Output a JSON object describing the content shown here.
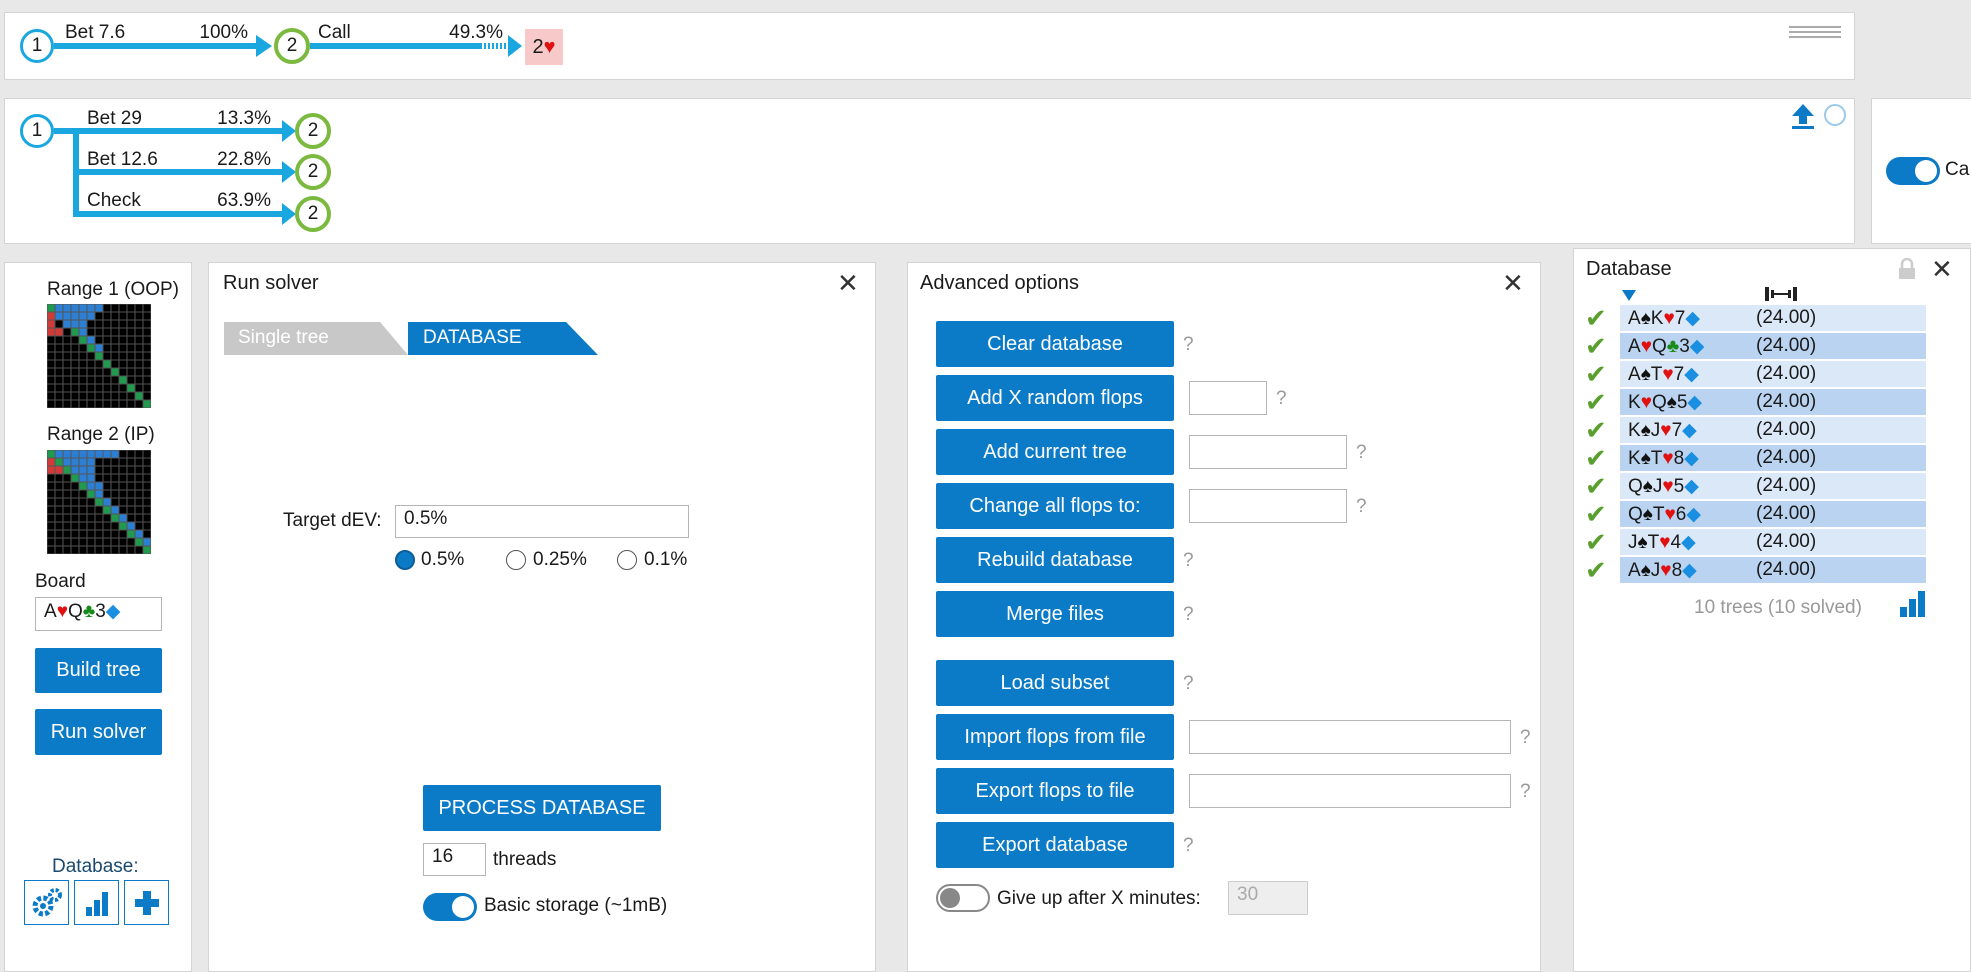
{
  "line1": {
    "node_a": "1",
    "action1": "Bet 7.6",
    "action1_pct": "100%",
    "node_b": "2",
    "action2": "Call",
    "action2_pct": "49.3%",
    "card_rank": "2",
    "card_suit": "♥"
  },
  "line2": {
    "node_root": "1",
    "branches": [
      {
        "label": "Bet 29",
        "pct": "13.3%",
        "node": "2"
      },
      {
        "label": "Bet 12.6",
        "pct": "22.8%",
        "node": "2"
      },
      {
        "label": "Check",
        "pct": "63.9%",
        "node": "2"
      }
    ]
  },
  "side_toggle_label": "Ca",
  "left": {
    "range1_title": "Range 1 (OOP)",
    "range2_title": "Range 2 (IP)",
    "board_label": "Board",
    "board_cards": [
      {
        "rank": "A",
        "suit": "♥",
        "color": "red"
      },
      {
        "rank": "Q",
        "suit": "♣",
        "color": "green"
      },
      {
        "rank": "3",
        "suit": "◆",
        "color": "blue"
      }
    ],
    "build_tree": "Build tree",
    "run_solver": "Run solver",
    "database_label": "Database:",
    "db_icons": [
      "gears-icon",
      "bar-chart-icon",
      "plus-icon"
    ]
  },
  "run_solver": {
    "title": "Run solver",
    "tab_single": "Single tree",
    "tab_database": "DATABASE",
    "target_label": "Target dEV:",
    "target_value": "0.5%",
    "radios": [
      {
        "label": "0.5%",
        "selected": true
      },
      {
        "label": "0.25%",
        "selected": false
      },
      {
        "label": "0.1%",
        "selected": false
      }
    ],
    "process_button": "PROCESS DATABASE",
    "threads_value": "16",
    "threads_label": "threads",
    "storage_label": "Basic storage (~1mB)",
    "storage_on": true
  },
  "advanced": {
    "title": "Advanced options",
    "buttons": [
      {
        "label": "Clear database"
      },
      {
        "label": "Add X random flops"
      },
      {
        "label": "Add current tree"
      },
      {
        "label": "Change all flops to:"
      },
      {
        "label": "Rebuild database"
      },
      {
        "label": "Merge files"
      },
      {
        "label": "Load subset"
      },
      {
        "label": "Import flops from file"
      },
      {
        "label": "Export flops to file"
      },
      {
        "label": "Export database"
      }
    ],
    "help": "?",
    "giveup_label": "Give up after X minutes:",
    "giveup_value": "30",
    "giveup_on": false
  },
  "database": {
    "title": "Database",
    "rows": [
      {
        "cards": [
          [
            "A",
            "♠",
            "black"
          ],
          [
            "K",
            "♥",
            "red"
          ],
          [
            "7",
            "◆",
            "blue"
          ]
        ],
        "value": "(24.00)"
      },
      {
        "cards": [
          [
            "A",
            "♥",
            "red"
          ],
          [
            "Q",
            "♣",
            "green"
          ],
          [
            "3",
            "◆",
            "blue"
          ]
        ],
        "value": "(24.00)"
      },
      {
        "cards": [
          [
            "A",
            "♠",
            "black"
          ],
          [
            "T",
            "♥",
            "red"
          ],
          [
            "7",
            "◆",
            "blue"
          ]
        ],
        "value": "(24.00)"
      },
      {
        "cards": [
          [
            "K",
            "♥",
            "red"
          ],
          [
            "Q",
            "♠",
            "black"
          ],
          [
            "5",
            "◆",
            "blue"
          ]
        ],
        "value": "(24.00)"
      },
      {
        "cards": [
          [
            "K",
            "♠",
            "black"
          ],
          [
            "J",
            "♥",
            "red"
          ],
          [
            "7",
            "◆",
            "blue"
          ]
        ],
        "value": "(24.00)"
      },
      {
        "cards": [
          [
            "K",
            "♠",
            "black"
          ],
          [
            "T",
            "♥",
            "red"
          ],
          [
            "8",
            "◆",
            "blue"
          ]
        ],
        "value": "(24.00)"
      },
      {
        "cards": [
          [
            "Q",
            "♠",
            "black"
          ],
          [
            "J",
            "♥",
            "red"
          ],
          [
            "5",
            "◆",
            "blue"
          ]
        ],
        "value": "(24.00)"
      },
      {
        "cards": [
          [
            "Q",
            "♠",
            "black"
          ],
          [
            "T",
            "♥",
            "red"
          ],
          [
            "6",
            "◆",
            "blue"
          ]
        ],
        "value": "(24.00)"
      },
      {
        "cards": [
          [
            "J",
            "♠",
            "black"
          ],
          [
            "T",
            "♥",
            "red"
          ],
          [
            "4",
            "◆",
            "blue"
          ]
        ],
        "value": "(24.00)"
      },
      {
        "cards": [
          [
            "A",
            "♠",
            "black"
          ],
          [
            "J",
            "♥",
            "red"
          ],
          [
            "8",
            "◆",
            "blue"
          ]
        ],
        "value": "(24.00)"
      }
    ],
    "summary": "10 trees (10 solved)"
  },
  "colors": {
    "accent": "#0c7bc7",
    "line": "#1aa7e0",
    "node2": "#7bb93f"
  }
}
